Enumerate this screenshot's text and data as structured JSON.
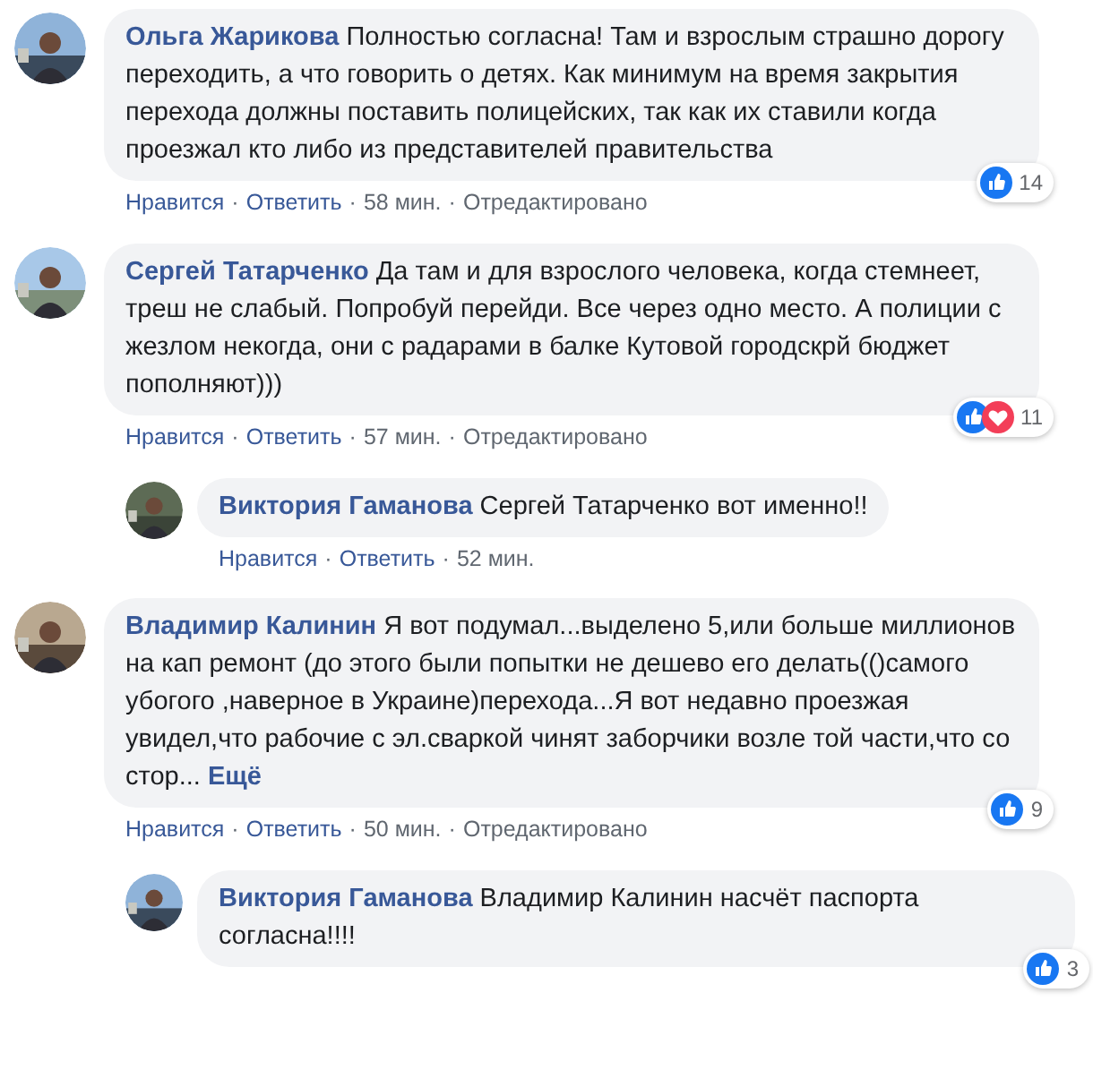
{
  "separator": "·",
  "comments": [
    {
      "author": "Ольга Жарикова",
      "text": "Полностью согласна! Там и взрослым страшно дорогу переходить, а что говорить о детях. Как минимум на время закрытия перехода должны поставить полицейских, так как их ставили когда проезжал кто либо из представителей правительства",
      "reactions": {
        "kinds": [
          {
            "kind": "like"
          }
        ],
        "count": "14"
      },
      "actions": [
        "Нравится",
        "Ответить",
        "58 мин.",
        "Отредактировано"
      ]
    },
    {
      "author": "Сергей Татарченко",
      "text": "Да там и для взрослого человека, когда стемнеет, треш не слабый. Попробуй перейди. Все через одно место. А полиции с жезлом некогда, они с радарами в балке Кутовой городскрй бюджет пополняют)))",
      "reactions": {
        "kinds": [
          {
            "kind": "like"
          },
          {
            "kind": "love"
          }
        ],
        "count": "11"
      },
      "actions": [
        "Нравится",
        "Ответить",
        "57 мин.",
        "Отредактировано"
      ],
      "replies": [
        {
          "author": "Виктория Гаманова",
          "text": "Сергей Татарченко вот именно!!",
          "actions": [
            "Нравится",
            "Ответить",
            "52 мин."
          ]
        }
      ]
    },
    {
      "author": "Владимир Калинин",
      "text": "Я вот подумал...выделено 5,или больше миллионов на кап ремонт (до этого были попытки не дешево его делать(()самого убогого ,наверное в Украине)перехода...Я вот недавно проезжая увидел,что рабочие с эл.сваркой чинят заборчики возле той части,что со стор...",
      "more": "Ещё",
      "reactions": {
        "kinds": [
          {
            "kind": "like"
          }
        ],
        "count": "9"
      },
      "actions": [
        "Нравится",
        "Ответить",
        "50 мин.",
        "Отредактировано"
      ],
      "replies": [
        {
          "author": "Виктория Гаманова",
          "text": "Владимир Калинин насчёт паспорта согласна!!!!",
          "reactions": {
            "kinds": [
              {
                "kind": "like"
              }
            ],
            "count": "3"
          }
        }
      ]
    }
  ]
}
